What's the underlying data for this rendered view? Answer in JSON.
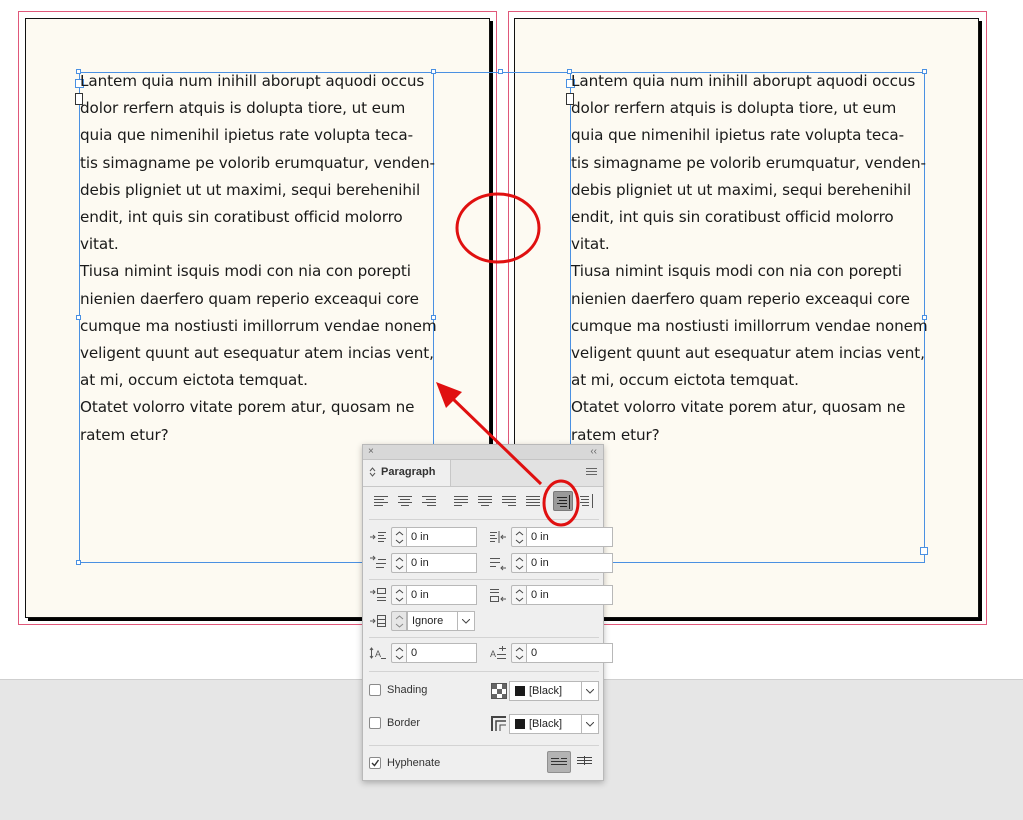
{
  "document": {
    "left_page_text": "Lantem quia num inihill aborupt aquodi occus\ndolor rerfern atquis is dolupta tiore, ut eum\nquia que nimenihil ipietus rate volupta teca-\ntis simagname pe volorib erumquatur, venden-\ndebis pligniet ut ut maximi, sequi berehenihil\nendit, int quis sin coratibust officid molorro\nvitat.\nTiusa nimint isquis modi con nia con porepti\nnienien daerfero quam reperio exceaqui core\ncumque ma nostiusti imillorrum vendae nonem\nveligent quunt aut esequatur atem incias vent,\nat mi, occum eictota temquat.\nOtatet volorro vitate porem atur, quosam ne\nratem etur?",
    "right_page_text": "Lantem quia num inihill aborupt aquodi occus\ndolor rerfern atquis is dolupta tiore, ut eum\nquia que nimenihil ipietus rate volupta teca-\ntis simagname pe volorib erumquatur, venden-\ndebis pligniet ut ut maximi, sequi berehenihil\nendit, int quis sin coratibust officid molorro\nvitat.\nTiusa nimint isquis modi con nia con porepti\nnienien daerfero quam reperio exceaqui core\ncumque ma nostiusti imillorrum vendae nonem\nveligent quunt aut esequatur atem incias vent,\nat mi, occum eictota temquat.\nOtatet volorro vitate porem atur, quosam ne\nratem etur?"
  },
  "panel": {
    "close_glyph": "×",
    "collapse_glyph": "‹‹",
    "tab_label": "Paragraph",
    "tab_arrows": "⌃⌄",
    "align_buttons": [
      "align-left",
      "align-center",
      "align-right",
      "justify-last-left",
      "justify-last-center",
      "justify-last-right",
      "justify-all",
      "align-towards-spine",
      "align-away-from-spine"
    ],
    "active_align": "align-towards-spine",
    "left_indent": "0 in",
    "right_indent": "0 in",
    "first_line_indent": "0 in",
    "last_line_indent": "0 in",
    "space_before": "0 in",
    "space_after": "0 in",
    "align_to_grid": "Ignore",
    "drop_cap_lines": "0",
    "drop_cap_chars": "0",
    "shading_label": "Shading",
    "shading_color": "[Black]",
    "border_label": "Border",
    "border_color": "[Black]",
    "hyphenate_label": "Hyphenate",
    "hyphenate_checked": true,
    "shading_checked": false,
    "border_checked": false
  },
  "colors": {
    "accent_annotation": "#e01010",
    "frame_blue": "#4a90e2",
    "bleed_pink": "#e0587a",
    "page_fill": "#fdfaf2"
  }
}
